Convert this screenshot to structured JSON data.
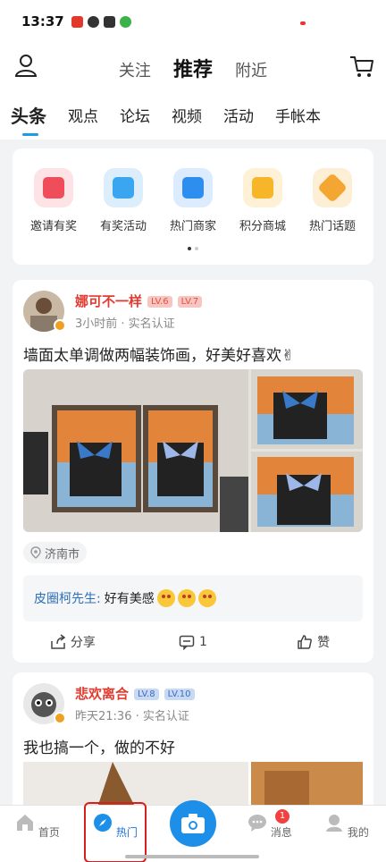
{
  "status": {
    "time": "13:37"
  },
  "header": {
    "tabs": [
      {
        "label": "关注"
      },
      {
        "label": "推荐"
      },
      {
        "label": "附近"
      }
    ]
  },
  "categories": [
    {
      "label": "头条"
    },
    {
      "label": "观点"
    },
    {
      "label": "论坛"
    },
    {
      "label": "视频"
    },
    {
      "label": "活动"
    },
    {
      "label": "手帐本"
    }
  ],
  "quick_actions": [
    {
      "label": "邀请有奖",
      "icon": "gift-invite-icon",
      "color": "#ef4d5a"
    },
    {
      "label": "有奖活动",
      "icon": "gift-box-icon",
      "color": "#3aa6ef"
    },
    {
      "label": "热门商家",
      "icon": "store-icon",
      "color": "#2d8ef0"
    },
    {
      "label": "积分商城",
      "icon": "shopping-bag-icon",
      "color": "#f7b52a"
    },
    {
      "label": "热门话题",
      "icon": "tag-icon",
      "color": "#f3a631"
    }
  ],
  "post1": {
    "username": "娜可不一样",
    "levels": [
      "LV.6",
      "LV.7"
    ],
    "meta": "3小时前 · 实名认证",
    "text": "墙面太单调做两幅装饰画，好美好喜欢✌",
    "location": "济南市",
    "comment": {
      "user": "皮圈柯先生:",
      "text": "好有美感"
    },
    "actions": {
      "share": "分享",
      "comments": "1",
      "like": "赞"
    }
  },
  "post2": {
    "username": "悲欢离合",
    "levels": [
      "LV.8",
      "LV.10"
    ],
    "meta": "昨天21:36 · 实名认证",
    "text": "我也搞一个，做的不好"
  },
  "bottom_nav": {
    "home": "首页",
    "hot": "热门",
    "messages": "消息",
    "messages_badge": "1",
    "me": "我的"
  },
  "colors": {
    "accent": "#1e9be6",
    "username": "#e23c31",
    "highlight_box": "#d91e1e"
  }
}
